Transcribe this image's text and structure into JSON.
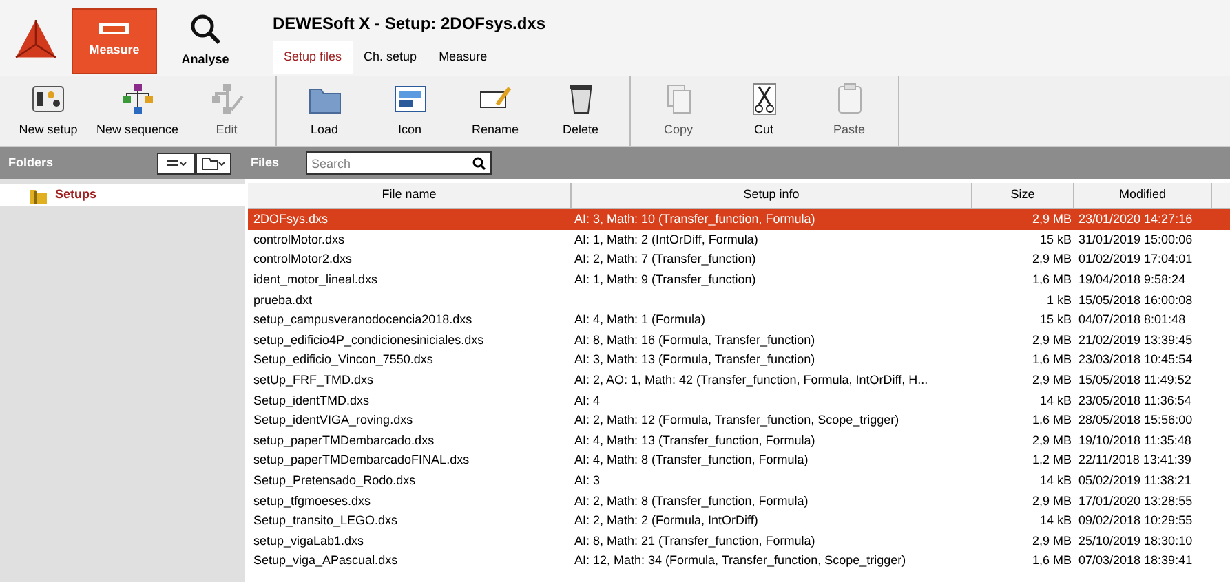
{
  "modes": [
    {
      "label": "Measure",
      "selected": true,
      "kind": "measure"
    },
    {
      "label": "Analyse",
      "selected": false,
      "kind": "analyse"
    }
  ],
  "window": {
    "title": "DEWESoft X - Setup: 2DOFsys.dxs"
  },
  "tabs": [
    {
      "label": "Setup files",
      "selected": true
    },
    {
      "label": "Ch. setup",
      "selected": false
    },
    {
      "label": "Measure",
      "selected": false
    }
  ],
  "toolbar_groups": [
    [
      {
        "label": "New setup",
        "kind": "new-setup",
        "disabled": false
      },
      {
        "label": "New sequence",
        "kind": "sequence",
        "disabled": false
      },
      {
        "label": "Edit",
        "kind": "edit",
        "disabled": true
      }
    ],
    [
      {
        "label": "Load",
        "kind": "folder",
        "disabled": false
      },
      {
        "label": "Icon",
        "kind": "image",
        "disabled": false
      },
      {
        "label": "Rename",
        "kind": "rename",
        "disabled": false
      },
      {
        "label": "Delete",
        "kind": "trash",
        "disabled": false
      }
    ],
    [
      {
        "label": "Copy",
        "kind": "copy",
        "disabled": true
      },
      {
        "label": "Cut",
        "kind": "scissors",
        "disabled": false
      },
      {
        "label": "Paste",
        "kind": "clipboard",
        "disabled": true
      }
    ]
  ],
  "folders_label": "Folders",
  "files_label": "Files",
  "search": {
    "placeholder": "Search"
  },
  "folders": [
    {
      "label": "Setups",
      "selected": true
    }
  ],
  "table": {
    "columns": [
      "File name",
      "Setup info",
      "Size",
      "Modified"
    ],
    "rows": [
      {
        "name": "2DOFsys.dxs",
        "info": "AI: 3, Math: 10 (Transfer_function, Formula)",
        "size": "2,9 MB",
        "modified": "23/01/2020 14:27:16",
        "selected": true
      },
      {
        "name": "controlMotor.dxs",
        "info": "AI: 1, Math: 2 (IntOrDiff, Formula)",
        "size": "15 kB",
        "modified": "31/01/2019 15:00:06",
        "selected": false
      },
      {
        "name": "controlMotor2.dxs",
        "info": "AI: 2, Math: 7 (Transfer_function)",
        "size": "2,9 MB",
        "modified": "01/02/2019 17:04:01",
        "selected": false
      },
      {
        "name": "ident_motor_lineal.dxs",
        "info": "AI: 1, Math: 9 (Transfer_function)",
        "size": "1,6 MB",
        "modified": "19/04/2018 9:58:24",
        "selected": false
      },
      {
        "name": "prueba.dxt",
        "info": "",
        "size": "1 kB",
        "modified": "15/05/2018 16:00:08",
        "selected": false
      },
      {
        "name": "setup_campusveranodocencia2018.dxs",
        "info": "AI: 4, Math: 1 (Formula)",
        "size": "15 kB",
        "modified": "04/07/2018 8:01:48",
        "selected": false
      },
      {
        "name": "setup_edificio4P_condicionesiniciales.dxs",
        "info": "AI: 8, Math: 16 (Formula, Transfer_function)",
        "size": "2,9 MB",
        "modified": "21/02/2019 13:39:45",
        "selected": false
      },
      {
        "name": "Setup_edificio_Vincon_7550.dxs",
        "info": "AI: 3, Math: 13 (Formula, Transfer_function)",
        "size": "1,6 MB",
        "modified": "23/03/2018 10:45:54",
        "selected": false
      },
      {
        "name": "setUp_FRF_TMD.dxs",
        "info": "AI: 2, AO: 1, Math: 42 (Transfer_function, Formula, IntOrDiff, H...",
        "size": "2,9 MB",
        "modified": "15/05/2018 11:49:52",
        "selected": false
      },
      {
        "name": "Setup_identTMD.dxs",
        "info": "AI: 4",
        "size": "14 kB",
        "modified": "23/05/2018 11:36:54",
        "selected": false
      },
      {
        "name": "Setup_identVIGA_roving.dxs",
        "info": "AI: 2, Math: 12 (Formula, Transfer_function, Scope_trigger)",
        "size": "1,6 MB",
        "modified": "28/05/2018 15:56:00",
        "selected": false
      },
      {
        "name": "setup_paperTMDembarcado.dxs",
        "info": "AI: 4, Math: 13 (Transfer_function, Formula)",
        "size": "2,9 MB",
        "modified": "19/10/2018 11:35:48",
        "selected": false
      },
      {
        "name": "setup_paperTMDembarcadoFINAL.dxs",
        "info": "AI: 4, Math: 8 (Transfer_function, Formula)",
        "size": "1,2 MB",
        "modified": "22/11/2018 13:41:39",
        "selected": false
      },
      {
        "name": "Setup_Pretensado_Rodo.dxs",
        "info": "AI: 3",
        "size": "14 kB",
        "modified": "05/02/2019 11:38:21",
        "selected": false
      },
      {
        "name": "setup_tfgmoeses.dxs",
        "info": "AI: 2, Math: 8 (Transfer_function, Formula)",
        "size": "2,9 MB",
        "modified": "17/01/2020 13:28:55",
        "selected": false
      },
      {
        "name": "Setup_transito_LEGO.dxs",
        "info": "AI: 2, Math: 2 (Formula, IntOrDiff)",
        "size": "14 kB",
        "modified": "09/02/2018 10:29:55",
        "selected": false
      },
      {
        "name": "setup_vigaLab1.dxs",
        "info": "AI: 8, Math: 21 (Transfer_function, Formula)",
        "size": "2,9 MB",
        "modified": "25/10/2019 18:30:10",
        "selected": false
      },
      {
        "name": "Setup_viga_APascual.dxs",
        "info": "AI: 12, Math: 34 (Formula, Transfer_function, Scope_trigger)",
        "size": "1,6 MB",
        "modified": "07/03/2018 18:39:41",
        "selected": false
      }
    ]
  }
}
